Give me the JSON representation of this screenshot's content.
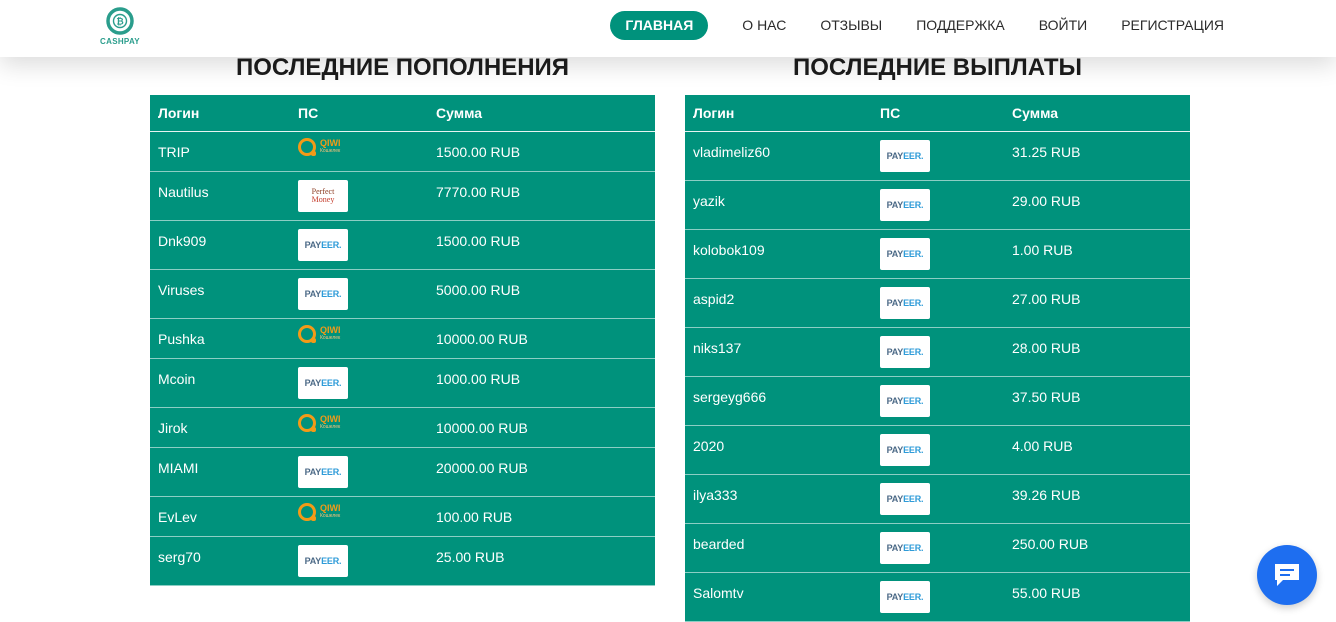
{
  "brand": {
    "name": "CASHPAY",
    "accent": "#00927c"
  },
  "nav": [
    {
      "label": "ГЛАВНАЯ",
      "active": true
    },
    {
      "label": "О НАС"
    },
    {
      "label": "ОТЗЫВЫ"
    },
    {
      "label": "ПОДДЕРЖКА"
    },
    {
      "label": "ВОЙТИ"
    },
    {
      "label": "РЕГИСТРАЦИЯ"
    }
  ],
  "deposits": {
    "title": "ПОСЛЕДНИЕ ПОПОЛНЕНИЯ",
    "columns": [
      "Логин",
      "ПС",
      "Сумма"
    ],
    "rows": [
      {
        "login": "TRIP",
        "ps": "qiwi",
        "amount": "1500.00 RUB"
      },
      {
        "login": "Nautilus",
        "ps": "perfectmoney",
        "amount": "7770.00 RUB"
      },
      {
        "login": "Dnk909",
        "ps": "payeer",
        "amount": "1500.00 RUB"
      },
      {
        "login": "Viruses",
        "ps": "payeer",
        "amount": "5000.00 RUB"
      },
      {
        "login": "Pushka",
        "ps": "qiwi",
        "amount": "10000.00 RUB"
      },
      {
        "login": "Mcoin",
        "ps": "payeer",
        "amount": "1000.00 RUB"
      },
      {
        "login": "Jirok",
        "ps": "qiwi",
        "amount": "10000.00 RUB"
      },
      {
        "login": "MIAMI",
        "ps": "payeer",
        "amount": "20000.00 RUB"
      },
      {
        "login": "EvLev",
        "ps": "qiwi",
        "amount": "100.00 RUB"
      },
      {
        "login": "serg70",
        "ps": "payeer",
        "amount": "25.00 RUB"
      }
    ]
  },
  "payouts": {
    "title": "ПОСЛЕДНИЕ ВЫПЛАТЫ",
    "columns": [
      "Логин",
      "ПС",
      "Сумма"
    ],
    "rows": [
      {
        "login": "vladimeliz60",
        "ps": "payeer",
        "amount": "31.25 RUB"
      },
      {
        "login": "yazik",
        "ps": "payeer",
        "amount": "29.00 RUB"
      },
      {
        "login": "kolobok109",
        "ps": "payeer",
        "amount": "1.00 RUB"
      },
      {
        "login": "aspid2",
        "ps": "payeer",
        "amount": "27.00 RUB"
      },
      {
        "login": "niks137",
        "ps": "payeer",
        "amount": "28.00 RUB"
      },
      {
        "login": "sergeyg666",
        "ps": "payeer",
        "amount": "37.50 RUB"
      },
      {
        "login": "2020",
        "ps": "payeer",
        "amount": "4.00 RUB"
      },
      {
        "login": "ilya333",
        "ps": "payeer",
        "amount": "39.26 RUB"
      },
      {
        "login": "bearded",
        "ps": "payeer",
        "amount": "250.00 RUB"
      },
      {
        "login": "Salomtv",
        "ps": "payeer",
        "amount": "55.00 RUB"
      }
    ]
  },
  "logos": {
    "payeer": [
      "PAY",
      "EER."
    ],
    "qiwi": [
      "QIWI",
      "Кошелек"
    ],
    "perfectmoney": [
      "Perfect",
      "Money"
    ]
  },
  "icons": {
    "logo": "bitcoin-coin-icon",
    "chat": "chat-bubble-icon"
  }
}
